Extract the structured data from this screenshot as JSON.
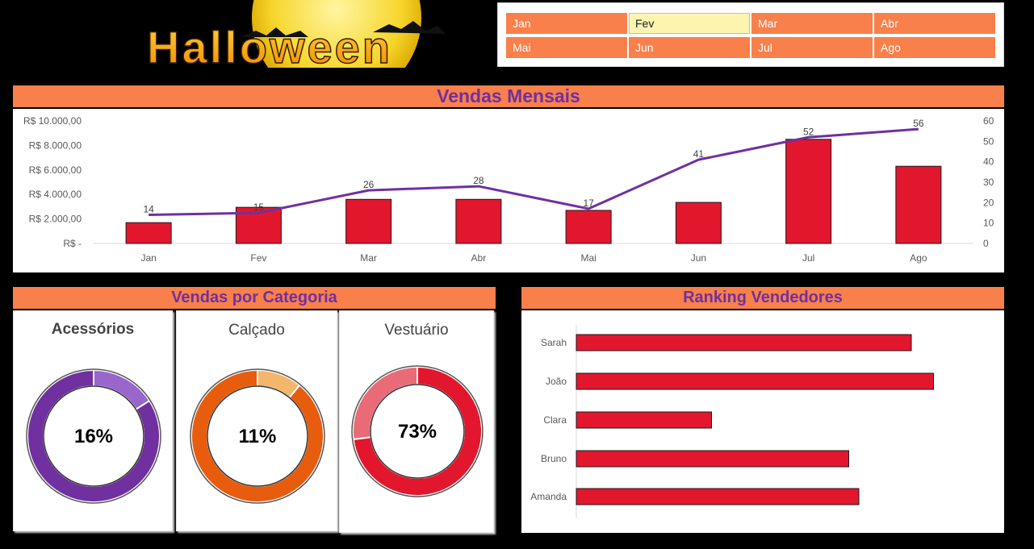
{
  "logo": {
    "text": "Halloween"
  },
  "slicer": {
    "months": [
      "Jan",
      "Fev",
      "Mar",
      "Abr",
      "Mai",
      "Jun",
      "Jul",
      "Ago"
    ],
    "selected": "Fev"
  },
  "sections": {
    "monthly_title": "Vendas Mensais",
    "category_title": "Vendas por Categoria",
    "ranking_title": "Ranking Vendedores"
  },
  "colors": {
    "accent_orange": "#f9804a",
    "title_purple": "#7030a0",
    "bar_red": "#e2172d",
    "line_purple": "#7030a0"
  },
  "chart_data": [
    {
      "type": "bar",
      "title": "Vendas Mensais",
      "categories": [
        "Jan",
        "Fev",
        "Mar",
        "Abr",
        "Mai",
        "Jun",
        "Jul",
        "Ago"
      ],
      "series": [
        {
          "values": [
            1700,
            2950,
            3600,
            3600,
            2700,
            3350,
            8500,
            6300
          ]
        },
        {
          "type": "line",
          "axis": "secondary",
          "values": [
            14,
            15,
            26,
            28,
            17,
            41,
            52,
            56
          ]
        }
      ],
      "ylim": [
        0,
        10000
      ],
      "y_ticks": [
        "R$ -",
        "R$ 2.000,00",
        "R$ 4.000,00",
        "R$ 6.000,00",
        "R$ 8.000,00",
        "R$ 10.000,00"
      ],
      "y2lim": [
        0,
        60
      ],
      "y2_ticks": [
        "0",
        "10",
        "20",
        "30",
        "40",
        "50",
        "60"
      ],
      "data_labels": [
        "14",
        "15",
        "26",
        "28",
        "17",
        "41",
        "52",
        "56"
      ],
      "grid": false
    },
    {
      "type": "pie",
      "variant": "donut",
      "title": "Acessórios",
      "values": [
        16,
        84
      ],
      "center_label": "16%",
      "colors": [
        "#9966cc",
        "#7030a0"
      ]
    },
    {
      "type": "pie",
      "variant": "donut",
      "title": "Calçado",
      "values": [
        11,
        89
      ],
      "center_label": "11%",
      "colors": [
        "#f3b66b",
        "#e85c0d"
      ]
    },
    {
      "type": "pie",
      "variant": "donut",
      "title": "Vestuário",
      "values": [
        73,
        27
      ],
      "center_label": "73%",
      "colors": [
        "#e2172d",
        "#e96b77"
      ]
    },
    {
      "type": "bar",
      "orientation": "horizontal",
      "title": "Ranking Vendedores",
      "categories": [
        "Sarah",
        "João",
        "Clara",
        "Bruno",
        "Amanda"
      ],
      "values": [
        0.83,
        0.885,
        0.335,
        0.675,
        0.7
      ]
    }
  ]
}
